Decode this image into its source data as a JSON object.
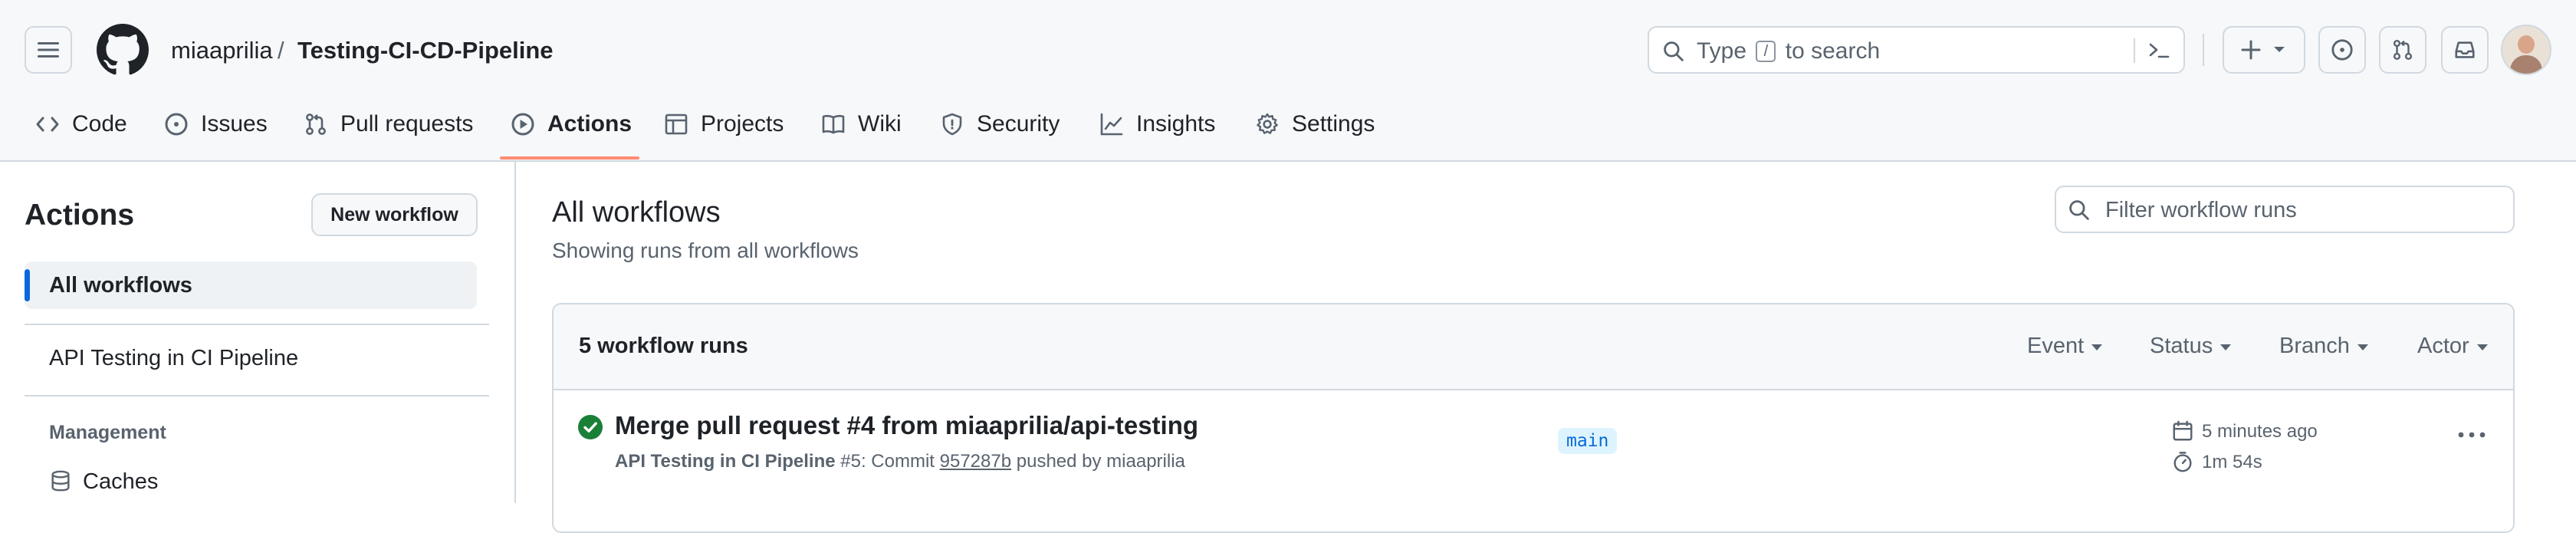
{
  "header": {
    "owner": "miaaprilia",
    "separator": "/",
    "repo": "Testing-CI-CD-Pipeline",
    "search": {
      "prefix": "Type",
      "key": "/",
      "suffix": "to search"
    }
  },
  "tabs": [
    {
      "label": "Code",
      "icon": "code-icon"
    },
    {
      "label": "Issues",
      "icon": "issue-opened-icon"
    },
    {
      "label": "Pull requests",
      "icon": "git-pull-request-icon"
    },
    {
      "label": "Actions",
      "icon": "play-icon",
      "active": true
    },
    {
      "label": "Projects",
      "icon": "table-icon"
    },
    {
      "label": "Wiki",
      "icon": "book-icon"
    },
    {
      "label": "Security",
      "icon": "shield-icon"
    },
    {
      "label": "Insights",
      "icon": "graph-icon"
    },
    {
      "label": "Settings",
      "icon": "gear-icon"
    }
  ],
  "sidebar": {
    "title": "Actions",
    "new_workflow": "New workflow",
    "items": [
      {
        "label": "All workflows",
        "selected": true
      },
      {
        "label": "API Testing in CI Pipeline",
        "selected": false
      }
    ],
    "management_heading": "Management",
    "management_items": [
      {
        "label": "Caches",
        "icon": "database-icon"
      }
    ]
  },
  "main": {
    "title": "All workflows",
    "subtitle": "Showing runs from all workflows",
    "filter_placeholder": "Filter workflow runs",
    "runs_count": "5 workflow runs",
    "filters": [
      "Event",
      "Status",
      "Branch",
      "Actor"
    ],
    "runs": [
      {
        "status": "success",
        "title": "Merge pull request #4 from miaaprilia/api-testing",
        "workflow": "API Testing in CI Pipeline",
        "run_number": "#5",
        "commit_prefix": ": Commit",
        "commit_sha": "957287b",
        "pushed_by": "pushed by miaaprilia",
        "branch": "main",
        "time_ago": "5 minutes ago",
        "duration": "1m 54s"
      }
    ]
  },
  "colors": {
    "accent_blue": "#0969da",
    "success_green": "#1a7f37",
    "active_tab_underline": "#fd8c73",
    "selected_bar": "#0969da"
  }
}
